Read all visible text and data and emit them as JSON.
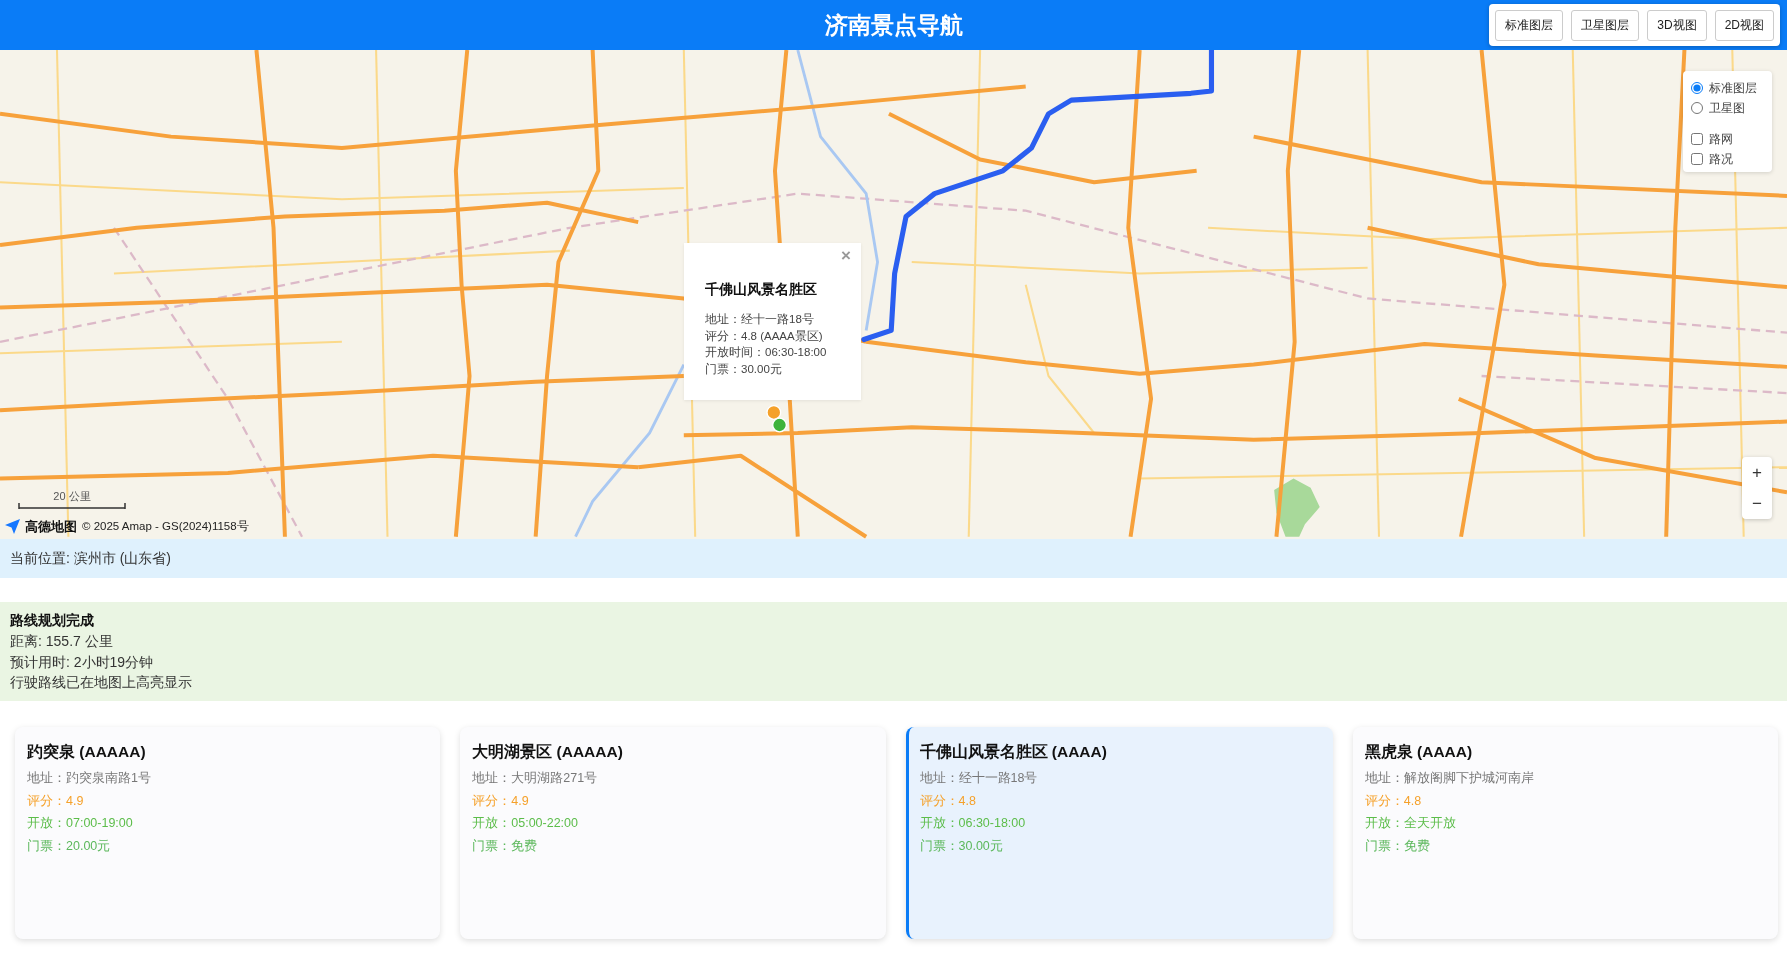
{
  "header": {
    "title": "济南景点导航",
    "buttons": [
      "标准图层",
      "卫星图层",
      "3D视图",
      "2D视图"
    ]
  },
  "map": {
    "layer_control": {
      "base_layers": [
        {
          "label": "标准图层",
          "selected": true
        },
        {
          "label": "卫星图",
          "selected": false
        }
      ],
      "overlays": [
        {
          "label": "路网",
          "checked": false
        },
        {
          "label": "路况",
          "checked": false
        }
      ]
    },
    "popup": {
      "title": "千佛山风景名胜区",
      "close": "×",
      "lines": [
        "地址：经十一路18号",
        "评分：4.8 (AAAA景区)",
        "开放时间：06:30-18:00",
        "门票：30.00元"
      ]
    },
    "markers": [
      {
        "color": "#f5a12a"
      },
      {
        "color": "#3db33a"
      }
    ],
    "zoom_buttons": [
      "+",
      "−"
    ],
    "scale": "20 公里",
    "attribution": {
      "logo": "高德地图",
      "copyright": "© 2025 Amap - GS(2024)1158号"
    }
  },
  "location": "当前位置: 滨州市 (山东省)",
  "route_info": {
    "title": "路线规划完成",
    "lines": [
      "距离: 155.7 公里",
      "预计用时: 2小时19分钟",
      "行驶路线已在地图上高亮显示"
    ]
  },
  "spots": [
    {
      "name": "趵突泉 (AAAAA)",
      "selected": false,
      "lines": [
        {
          "kind": "address",
          "text": "地址：趵突泉南路1号"
        },
        {
          "kind": "rating",
          "text": "评分：4.9"
        },
        {
          "kind": "hours",
          "text": "开放：07:00-19:00"
        },
        {
          "kind": "ticket",
          "text": "门票：20.00元"
        }
      ]
    },
    {
      "name": "大明湖景区 (AAAAA)",
      "selected": false,
      "lines": [
        {
          "kind": "address",
          "text": "地址：大明湖路271号"
        },
        {
          "kind": "rating",
          "text": "评分：4.9"
        },
        {
          "kind": "hours",
          "text": "开放：05:00-22:00"
        },
        {
          "kind": "ticket",
          "text": "门票：免费"
        }
      ]
    },
    {
      "name": "千佛山风景名胜区 (AAAA)",
      "selected": true,
      "lines": [
        {
          "kind": "address",
          "text": "地址：经十一路18号"
        },
        {
          "kind": "rating",
          "text": "评分：4.8"
        },
        {
          "kind": "hours",
          "text": "开放：06:30-18:00"
        },
        {
          "kind": "ticket",
          "text": "门票：30.00元"
        }
      ]
    },
    {
      "name": "黑虎泉 (AAAA)",
      "selected": false,
      "lines": [
        {
          "kind": "address",
          "text": "地址：解放阁脚下护城河南岸"
        },
        {
          "kind": "rating",
          "text": "评分：4.8"
        },
        {
          "kind": "hours",
          "text": "开放：全天开放"
        },
        {
          "kind": "ticket",
          "text": "门票：免费"
        }
      ]
    }
  ]
}
